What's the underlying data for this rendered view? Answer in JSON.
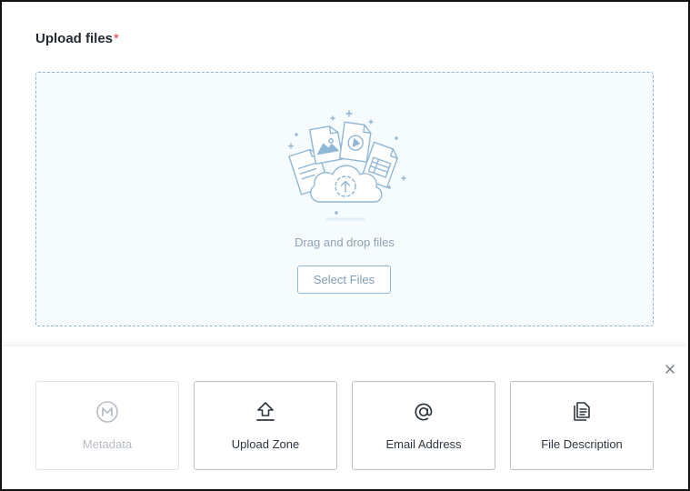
{
  "upload": {
    "title": "Upload files",
    "required_mark": "*",
    "drag_text": "Drag and drop files",
    "select_button": "Select Files"
  },
  "options": {
    "close_icon": "close-icon",
    "cards": [
      {
        "label": "Metadata",
        "icon": "metadata-icon",
        "disabled": true
      },
      {
        "label": "Upload Zone",
        "icon": "upload-icon",
        "disabled": false
      },
      {
        "label": "Email Address",
        "icon": "at-sign-icon",
        "disabled": false
      },
      {
        "label": "File Description",
        "icon": "file-description-icon",
        "disabled": false
      }
    ]
  },
  "colors": {
    "accent": "#8fb7d6",
    "dropzone_bg": "#f6fbfd",
    "required": "#d9363e",
    "text_dark": "#222a33",
    "text_muted": "#8da3b5",
    "disabled": "#b7bdc4"
  }
}
